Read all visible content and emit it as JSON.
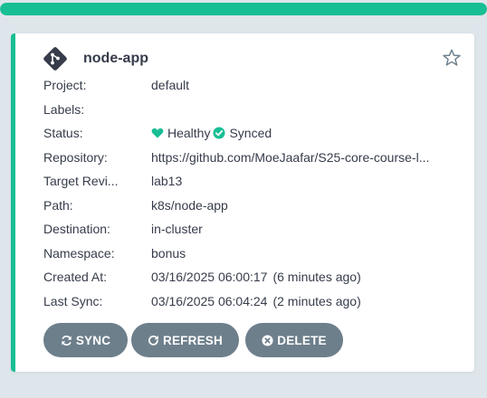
{
  "progress": {
    "fraction": 1.0,
    "color": "#18be94"
  },
  "app": {
    "name": "node-app",
    "icon": "git-icon",
    "favorite_icon": "star-outline-icon",
    "status_color": "#18be94"
  },
  "fields": {
    "project": {
      "label": "Project:",
      "value": "default"
    },
    "labels": {
      "label": "Labels:",
      "value": ""
    },
    "status": {
      "label": "Status:",
      "health": "Healthy",
      "health_icon": "heart-icon",
      "sync": "Synced",
      "sync_icon": "check-circle-icon"
    },
    "repository": {
      "label": "Repository:",
      "value": "https://github.com/MoeJaafar/S25-core-course-l..."
    },
    "target_revision": {
      "label": "Target Revi...",
      "value": "lab13"
    },
    "path": {
      "label": "Path:",
      "value": "k8s/node-app"
    },
    "destination": {
      "label": "Destination:",
      "value": "in-cluster"
    },
    "namespace": {
      "label": "Namespace:",
      "value": "bonus"
    },
    "created_at": {
      "label": "Created At:",
      "value": "03/16/2025 06:00:17",
      "ago": "(6 minutes ago)"
    },
    "last_sync": {
      "label": "Last Sync:",
      "value": "03/16/2025 06:04:24",
      "ago": "(2 minutes ago)"
    }
  },
  "actions": {
    "sync": {
      "label": "SYNC",
      "icon": "sync-icon"
    },
    "refresh": {
      "label": "REFRESH",
      "icon": "refresh-icon"
    },
    "delete": {
      "label": "DELETE",
      "icon": "times-circle-icon"
    }
  }
}
